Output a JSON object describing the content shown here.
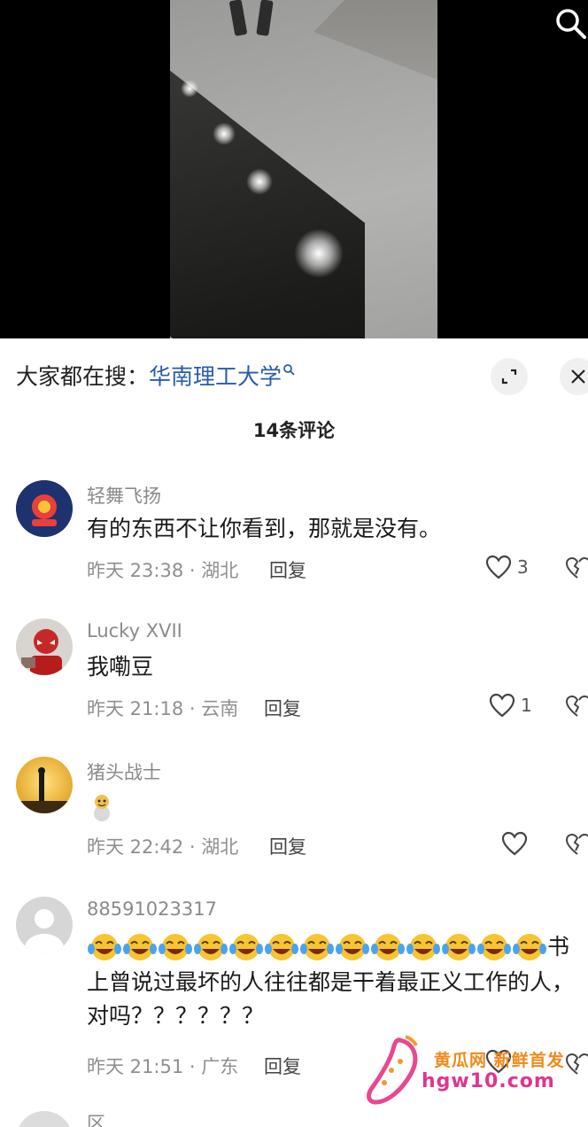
{
  "header": {
    "search_icon": "search-icon"
  },
  "sheet": {
    "search_prefix": "大家都在搜：",
    "search_keyword": "华南理工大学",
    "expand_icon": "expand-icon",
    "close_icon": "close-icon",
    "comment_count": "14条评论"
  },
  "comments": [
    {
      "user": "轻舞飞扬",
      "text": "有的东西不让你看到，那就是没有。",
      "meta": "昨天 23:38 · 湖北",
      "reply": "回复",
      "likes": "3"
    },
    {
      "user": "Lucky XVII",
      "text": "我嘞豆",
      "meta": "昨天 21:18 · 云南",
      "reply": "回复",
      "likes": "1"
    },
    {
      "user": "猪头战士",
      "text": "",
      "meta": "昨天 22:42 · 湖北",
      "reply": "回复",
      "likes": ""
    },
    {
      "user": "88591023317",
      "text_end": "书",
      "text": "上曾说过最坏的人往往都是干着最正义工作的人，对吗？？？？？？",
      "meta": "昨天 21:51 · 广东",
      "reply": "回复",
      "likes": ""
    },
    {
      "user": "区"
    }
  ],
  "watermark": {
    "line1": "黄瓜网 新鲜首发",
    "line2": "hgw10.com"
  },
  "colors": {
    "accent_blue": "#2a5caa",
    "meta_gray": "#8f8f8f",
    "watermark_orange": "#f08a1c",
    "watermark_pink": "#e0358f"
  }
}
